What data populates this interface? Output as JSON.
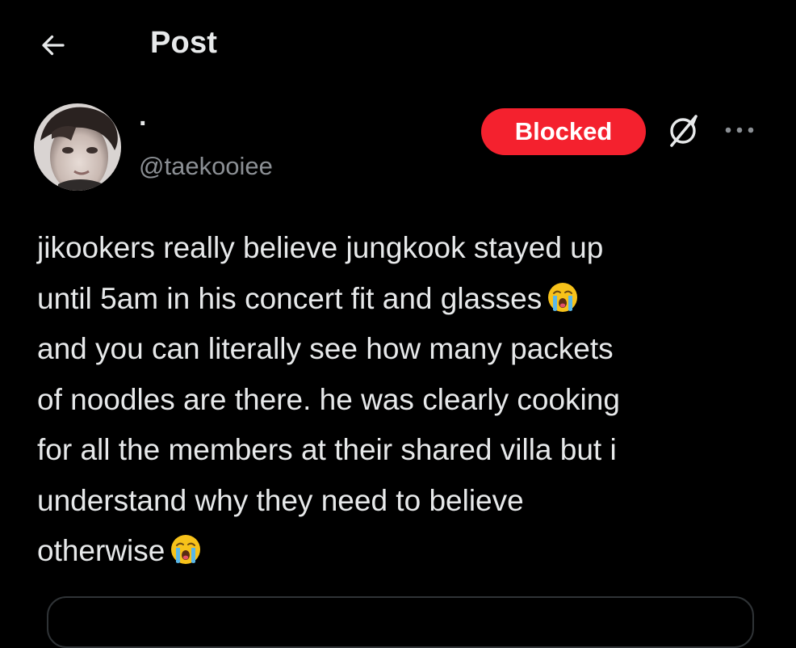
{
  "header": {
    "back_icon": "arrow-left-icon",
    "title": "Post"
  },
  "author": {
    "display_name": "·",
    "handle": "@taekooiee",
    "relationship_button": "Blocked",
    "grok_icon": "grok-icon",
    "more_icon": "more-horizontal-icon"
  },
  "tweet": {
    "lines": [
      "jikookers really believe jungkook stayed up",
      "until 5am in his concert fit and glasses",
      "and you can literally see how many packets",
      "of noodles are there. he was clearly cooking",
      "for all the members at their shared villa but i",
      "understand why they need to believe",
      "otherwise"
    ],
    "emoji": "😭",
    "emoji_icon": "loudly-crying-face-icon"
  },
  "colors": {
    "background": "#000000",
    "text": "#e7e9ea",
    "secondary_text": "#8b8f94",
    "blocked_red": "#f4212e"
  }
}
